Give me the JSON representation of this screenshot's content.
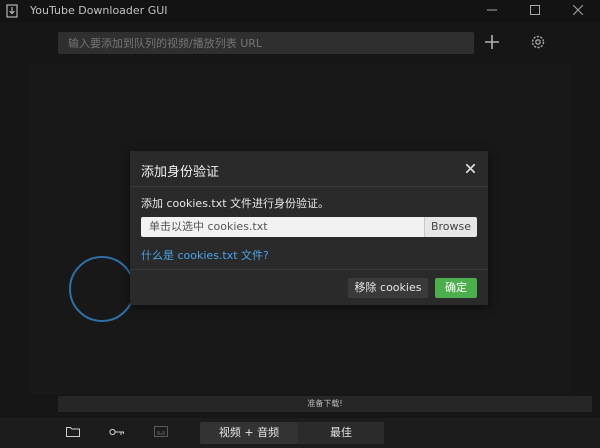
{
  "window": {
    "title": "YouTube Downloader GUI"
  },
  "toolbar": {
    "url_placeholder": "输入要添加到队列的视频/播放列表 URL"
  },
  "dialog": {
    "title": "添加身份验证",
    "description": "添加 cookies.txt 文件进行身份验证。",
    "file_placeholder": "单击以选中 cookies.txt",
    "browse_label": "Browse",
    "help_link": "什么是 cookies.txt 文件?",
    "remove_label": "移除 cookies",
    "ok_label": "确定"
  },
  "status": {
    "text": "准备下载!"
  },
  "bottom": {
    "format_label": "视频 + 音频",
    "quality_label": "最佳"
  },
  "colors": {
    "accent_green": "#4cae4c",
    "link_blue": "#4aa3e8",
    "background": "#1c1c1c"
  },
  "icons": [
    "app-icon",
    "minimize-icon",
    "maximize-icon",
    "close-icon",
    "plus-icon",
    "gear-icon",
    "dialog-close-icon",
    "folder-icon",
    "key-icon",
    "subtitle-icon",
    "loading-spinner"
  ]
}
